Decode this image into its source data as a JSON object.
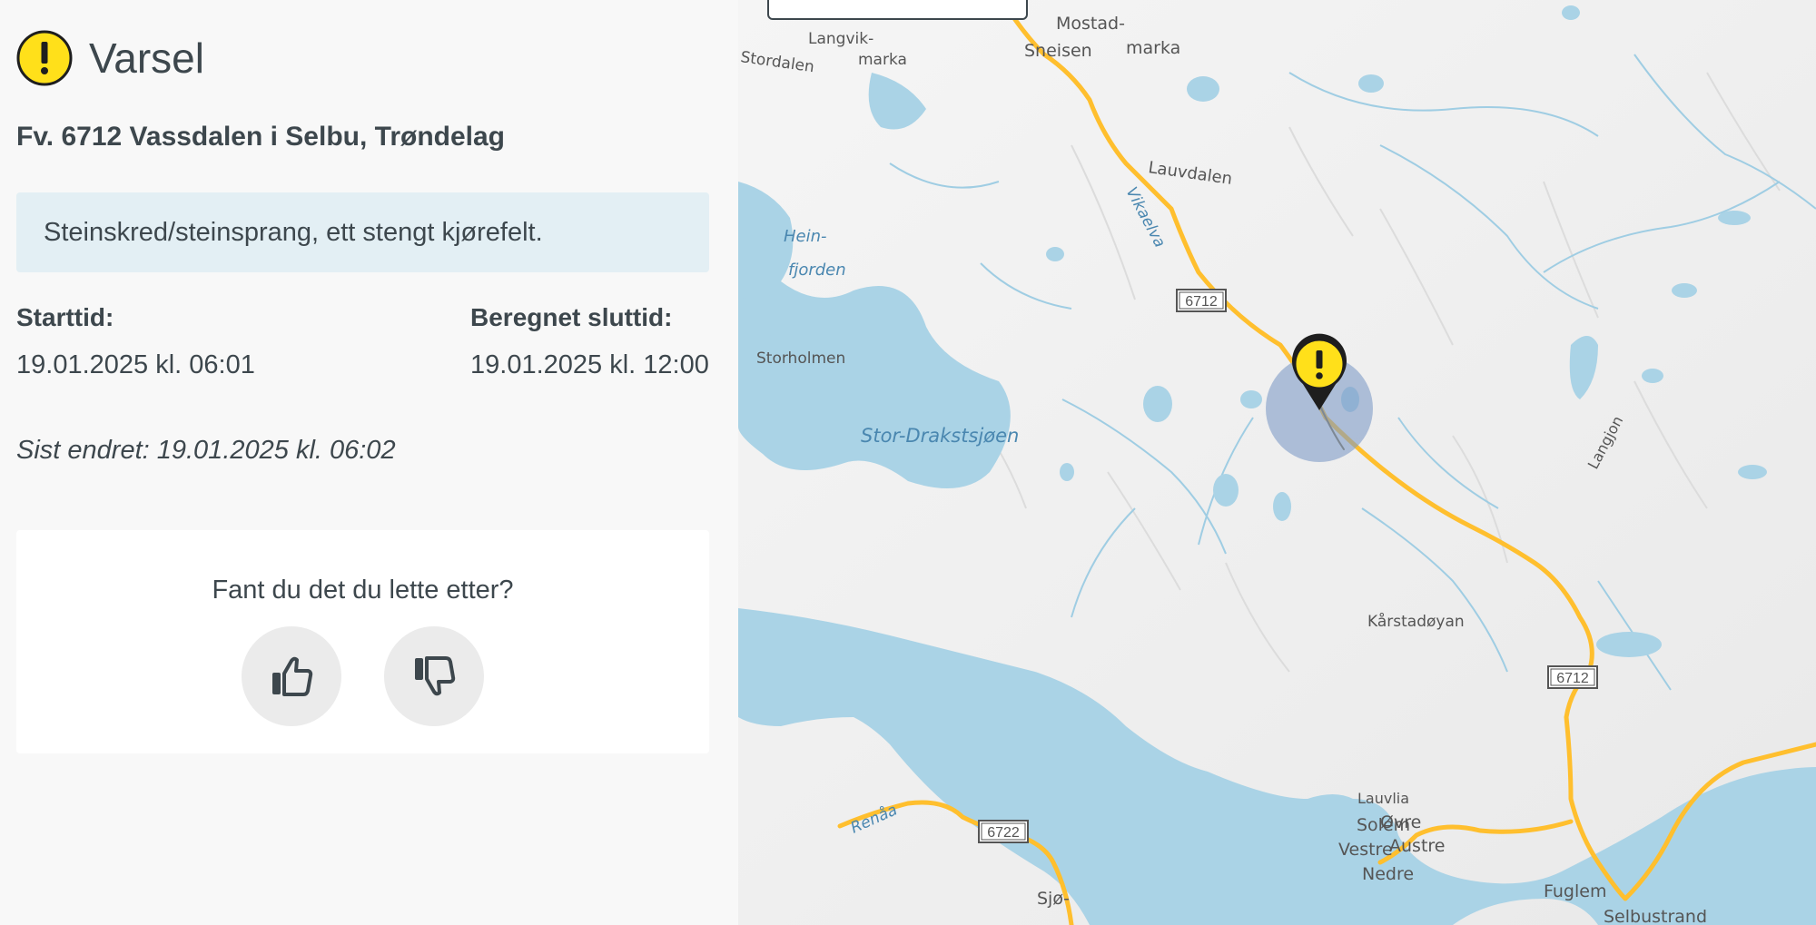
{
  "panel": {
    "title": "Varsel",
    "road": "Fv. 6712 Vassdalen i Selbu, Trøndelag",
    "description": "Steinskred/steinsprang, ett stengt kjørefelt.",
    "start_label": "Starttid:",
    "start_value": "19.01.2025 kl. 06:01",
    "end_label": "Beregnet sluttid:",
    "end_value": "19.01.2025 kl. 12:00",
    "last_changed": "Sist endret: 19.01.2025 kl. 06:02",
    "feedback_question": "Fant du det du lette etter?",
    "icons": {
      "header": "warning-icon",
      "yes": "thumbs-up-icon",
      "no": "thumbs-down-icon"
    }
  },
  "map": {
    "place_labels": {
      "stordalen": "Stordalen",
      "langvikmarka_1": "Langvik-",
      "langvikmarka_2": "marka",
      "mostad_1": "Mostad-",
      "mostad_2": "marka",
      "sneisen": "Sneisen",
      "lauvdalen": "Lauvdalen",
      "vikaelva": "Vikaelva",
      "heinfjorden_1": "Hein-",
      "heinfjorden_2": "fjorden",
      "storholmen": "Storholmen",
      "stor_drakstsjoen": "Stor-Drakstsjøen",
      "langjon": "Langjon",
      "karstadoyan": "Kårstadøyan",
      "lauvlia": "Lauvlia",
      "solem": "Solem",
      "ovre": "Øvre",
      "austre": "Austre",
      "vestre": "Vestre",
      "nedre": "Nedre",
      "fuglem": "Fuglem",
      "selbustrand": "Selbustrand",
      "renaa": "Renåa",
      "sjo": "Sjø-"
    },
    "road_shields": {
      "r1": "6712",
      "r2": "6712",
      "r3": "6722"
    },
    "colors": {
      "water": "#aad3e6",
      "land": "#f2f2f2",
      "road": "#ffbf2e",
      "marker": "#ffe01a",
      "area": "#7f9bc7"
    },
    "marker_icon": "warning-marker-icon"
  }
}
